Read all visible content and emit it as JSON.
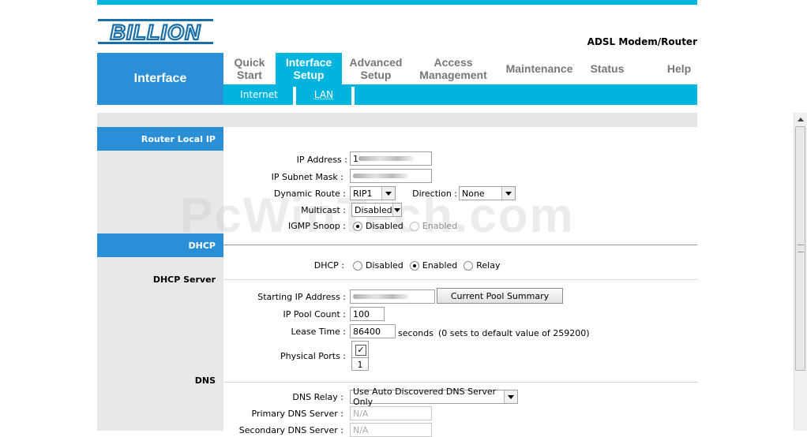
{
  "brand": {
    "logo_text": "BILLION",
    "product": "ADSL Modem/Router"
  },
  "section_title": "Interface",
  "nav": [
    {
      "line1": "Quick",
      "line2": "Start",
      "active": false
    },
    {
      "line1": "Interface",
      "line2": "Setup",
      "active": true
    },
    {
      "line1": "Advanced",
      "line2": "Setup",
      "active": false
    },
    {
      "line1": "Access",
      "line2": "Management",
      "active": false
    },
    {
      "line1": "Maintenance",
      "line2": "",
      "active": false
    },
    {
      "line1": "Status",
      "line2": "",
      "active": false
    },
    {
      "line1": "Help",
      "line2": "",
      "active": false
    }
  ],
  "subnav": {
    "internet": "Internet",
    "lan": "LAN"
  },
  "sections": {
    "router_local_ip": "Router Local IP",
    "dhcp": "DHCP",
    "dhcp_server": "DHCP Server",
    "dns": "DNS"
  },
  "router": {
    "ip_address_label": "IP Address :",
    "ip_address_value": "1",
    "subnet_label": "IP Subnet Mask :",
    "dynamic_route_label": "Dynamic Route :",
    "dynamic_route_value": "RIP1",
    "direction_label": "Direction :",
    "direction_value": "None",
    "multicast_label": "Multicast :",
    "multicast_value": "Disabled",
    "igmp_label": "IGMP Snoop :",
    "igmp_disabled": "Disabled",
    "igmp_enabled": "Enabled"
  },
  "dhcp": {
    "label": "DHCP :",
    "opt_disabled": "Disabled",
    "opt_enabled": "Enabled",
    "opt_relay": "Relay",
    "start_ip_label": "Starting IP Address :",
    "pool_button": "Current Pool Summary",
    "pool_count_label": "IP Pool Count :",
    "pool_count_value": "100",
    "lease_label": "Lease Time :",
    "lease_value": "86400",
    "lease_unit": "seconds",
    "lease_note": "(0 sets to default value of 259200)",
    "ports_label": "Physical Ports :",
    "port_number": "1"
  },
  "dns": {
    "relay_label": "DNS Relay :",
    "relay_value": "Use Auto Discovered DNS Server Only",
    "primary_label": "Primary DNS Server :",
    "primary_value": "N/A",
    "secondary_label": "Secondary DNS Server :",
    "secondary_value": "N/A"
  },
  "watermark": "PcWinTech.com",
  "colors": {
    "accent": "#00b4e0",
    "section_blue": "#2a8fd6"
  }
}
